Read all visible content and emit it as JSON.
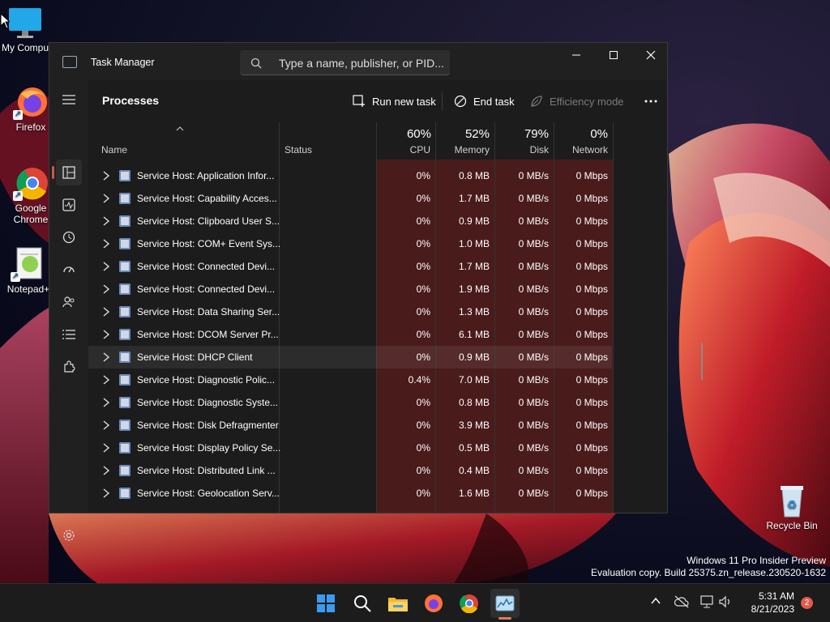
{
  "desktop": {
    "icons": [
      {
        "label": "My Compu"
      },
      {
        "label": "Firefox"
      },
      {
        "label": "Google Chrome"
      },
      {
        "label": "Notepad+"
      },
      {
        "label": "Recycle Bin"
      }
    ],
    "watermark": {
      "line1": "Windows 11 Pro Insider Preview",
      "line2": "Evaluation copy. Build 25375.zn_release.230520-1632"
    }
  },
  "window": {
    "title": "Task Manager",
    "search_placeholder": "Type a name, publisher, or PID...",
    "page_title": "Processes",
    "commands": {
      "run_new_task": "Run new task",
      "end_task": "End task",
      "efficiency_mode": "Efficiency mode"
    },
    "nav_icons": [
      "hamburger-icon",
      "processes-icon",
      "performance-icon",
      "app-history-icon",
      "startup-apps-icon",
      "users-icon",
      "details-icon",
      "services-icon",
      "settings-icon"
    ]
  },
  "columns": {
    "name": "Name",
    "status": "Status",
    "cpu": {
      "pct": "60%",
      "label": "CPU"
    },
    "memory": {
      "pct": "52%",
      "label": "Memory"
    },
    "disk": {
      "pct": "79%",
      "label": "Disk"
    },
    "network": {
      "pct": "0%",
      "label": "Network"
    }
  },
  "processes": [
    {
      "name": "Service Host: Application Infor...",
      "cpu": "0%",
      "memory": "0.8 MB",
      "disk": "0 MB/s",
      "network": "0 Mbps"
    },
    {
      "name": "Service Host: Capability Acces...",
      "cpu": "0%",
      "memory": "1.7 MB",
      "disk": "0 MB/s",
      "network": "0 Mbps"
    },
    {
      "name": "Service Host: Clipboard User S...",
      "cpu": "0%",
      "memory": "0.9 MB",
      "disk": "0 MB/s",
      "network": "0 Mbps"
    },
    {
      "name": "Service Host: COM+ Event Sys...",
      "cpu": "0%",
      "memory": "1.0 MB",
      "disk": "0 MB/s",
      "network": "0 Mbps"
    },
    {
      "name": "Service Host: Connected Devi...",
      "cpu": "0%",
      "memory": "1.7 MB",
      "disk": "0 MB/s",
      "network": "0 Mbps"
    },
    {
      "name": "Service Host: Connected Devi...",
      "cpu": "0%",
      "memory": "1.9 MB",
      "disk": "0 MB/s",
      "network": "0 Mbps"
    },
    {
      "name": "Service Host: Data Sharing Ser...",
      "cpu": "0%",
      "memory": "1.3 MB",
      "disk": "0 MB/s",
      "network": "0 Mbps"
    },
    {
      "name": "Service Host: DCOM Server Pr...",
      "cpu": "0%",
      "memory": "6.1 MB",
      "disk": "0 MB/s",
      "network": "0 Mbps"
    },
    {
      "name": "Service Host: DHCP Client",
      "cpu": "0%",
      "memory": "0.9 MB",
      "disk": "0 MB/s",
      "network": "0 Mbps"
    },
    {
      "name": "Service Host: Diagnostic Polic...",
      "cpu": "0.4%",
      "memory": "7.0 MB",
      "disk": "0 MB/s",
      "network": "0 Mbps"
    },
    {
      "name": "Service Host: Diagnostic Syste...",
      "cpu": "0%",
      "memory": "0.8 MB",
      "disk": "0 MB/s",
      "network": "0 Mbps"
    },
    {
      "name": "Service Host: Disk Defragmenter",
      "cpu": "0%",
      "memory": "3.9 MB",
      "disk": "0 MB/s",
      "network": "0 Mbps"
    },
    {
      "name": "Service Host: Display Policy Se...",
      "cpu": "0%",
      "memory": "0.5 MB",
      "disk": "0 MB/s",
      "network": "0 Mbps"
    },
    {
      "name": "Service Host: Distributed Link ...",
      "cpu": "0%",
      "memory": "0.4 MB",
      "disk": "0 MB/s",
      "network": "0 Mbps"
    },
    {
      "name": "Service Host: Geolocation Serv...",
      "cpu": "0%",
      "memory": "1.6 MB",
      "disk": "0 MB/s",
      "network": "0 Mbps"
    }
  ],
  "selected_process": "Service Host: DHCP Client",
  "taskbar": {
    "apps": [
      "start-icon",
      "search-icon",
      "file-explorer-icon",
      "firefox-icon",
      "chrome-icon",
      "task-manager-icon"
    ],
    "time": "5:31 AM",
    "date": "8/21/2023",
    "notifications": "2"
  },
  "colors": {
    "accent": "#c65a4b",
    "heat": "#4a1b1b",
    "window_bg": "#202020"
  }
}
